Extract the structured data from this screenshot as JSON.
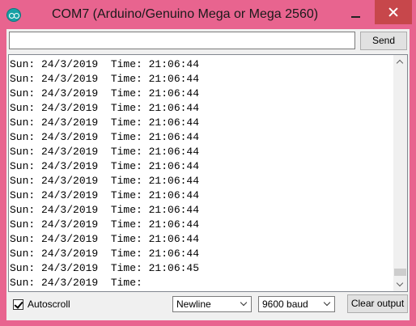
{
  "window": {
    "title": "COM7 (Arduino/Genuino Mega or Mega 2560)",
    "icons": {
      "app": "arduino-icon",
      "minimize": "minimize-icon",
      "close": "close-icon"
    }
  },
  "send_bar": {
    "input_value": "",
    "send_label": "Send"
  },
  "output": {
    "lines": [
      "Sun: 24/3/2019  Time: 21:06:44",
      "Sun: 24/3/2019  Time: 21:06:44",
      "Sun: 24/3/2019  Time: 21:06:44",
      "Sun: 24/3/2019  Time: 21:06:44",
      "Sun: 24/3/2019  Time: 21:06:44",
      "Sun: 24/3/2019  Time: 21:06:44",
      "Sun: 24/3/2019  Time: 21:06:44",
      "Sun: 24/3/2019  Time: 21:06:44",
      "Sun: 24/3/2019  Time: 21:06:44",
      "Sun: 24/3/2019  Time: 21:06:44",
      "Sun: 24/3/2019  Time: 21:06:44",
      "Sun: 24/3/2019  Time: 21:06:44",
      "Sun: 24/3/2019  Time: 21:06:44",
      "Sun: 24/3/2019  Time: 21:06:44",
      "Sun: 24/3/2019  Time: 21:06:44",
      "Sun: 24/3/2019  Time: 21:06:45",
      "Sun: 24/3/2019  Time:"
    ]
  },
  "bottom_bar": {
    "autoscroll_label": "Autoscroll",
    "autoscroll_checked": true,
    "line_ending": "Newline",
    "baud_rate": "9600 baud",
    "clear_label": "Clear output"
  },
  "colors": {
    "titlebar": "#e8648f",
    "close_button": "#c7474b",
    "app_icon": "#17a1a5"
  }
}
